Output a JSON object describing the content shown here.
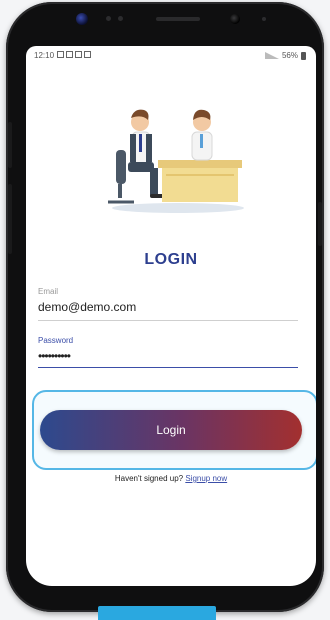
{
  "status_bar": {
    "time": "12:10",
    "battery_text": "56%"
  },
  "login": {
    "title": "LOGIN",
    "email": {
      "label": "Email",
      "value": "demo@demo.com"
    },
    "password": {
      "label": "Password",
      "masked_value": "••••••••••"
    },
    "button_label": "Login",
    "signup_prompt": "Haven't signed up?",
    "signup_link": "Signup now"
  },
  "colors": {
    "accent": "#2d3f8f",
    "button_gradient_start": "#2d4a8e",
    "button_gradient_end": "#a3302f",
    "focus_ring": "#55b7e6"
  },
  "icons": [
    "office-illustration-icon",
    "front-camera-icon",
    "battery-icon",
    "signal-icon"
  ]
}
